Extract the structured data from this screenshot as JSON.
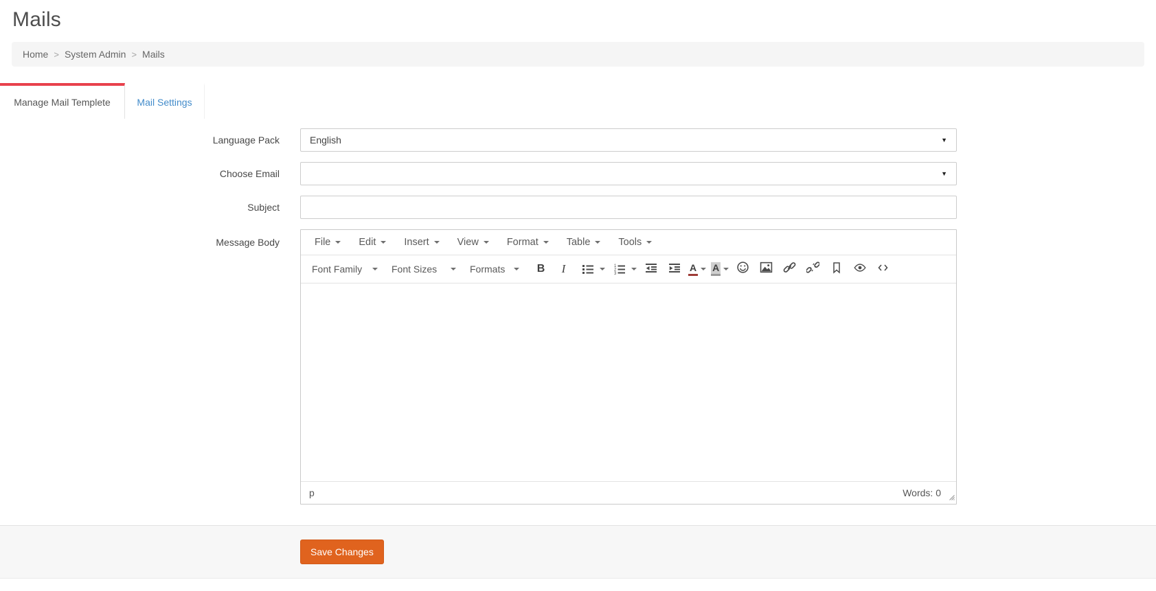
{
  "page": {
    "title": "Mails"
  },
  "breadcrumb": {
    "separator": ">",
    "items": [
      {
        "label": "Home"
      },
      {
        "label": "System Admin"
      },
      {
        "label": "Mails"
      }
    ]
  },
  "tabs": {
    "manage": {
      "label": "Manage Mail Templete",
      "active": true
    },
    "settings": {
      "label": "Mail Settings",
      "active": false
    }
  },
  "form": {
    "language_pack": {
      "label": "Language Pack",
      "value": "English"
    },
    "choose_email": {
      "label": "Choose Email",
      "value": ""
    },
    "subject": {
      "label": "Subject",
      "value": "",
      "placeholder": ""
    },
    "message_body": {
      "label": "Message Body",
      "content": ""
    }
  },
  "editor": {
    "menubar": {
      "file": "File",
      "edit": "Edit",
      "insert": "Insert",
      "view": "View",
      "format": "Format",
      "table": "Table",
      "tools": "Tools"
    },
    "toolbar": {
      "font_family": "Font Family",
      "font_sizes": "Font Sizes",
      "formats": "Formats",
      "bold": "B",
      "italic": "I",
      "forecolor": "A",
      "backcolor": "A",
      "icons": [
        "bullet-list-icon",
        "numbered-list-icon",
        "outdent-icon",
        "indent-icon",
        "emoticons-icon",
        "image-icon",
        "link-icon",
        "unlink-icon",
        "anchor-icon",
        "preview-icon",
        "code-icon"
      ]
    },
    "statusbar": {
      "path": "p",
      "words_label": "Words:",
      "word_count": "0"
    }
  },
  "footer": {
    "save_label": "Save Changes"
  },
  "colors": {
    "tab_accent": "#e8414c",
    "link_blue": "#428bca",
    "save_button": "#e0631e",
    "panel_gray": "#f5f5f5"
  }
}
